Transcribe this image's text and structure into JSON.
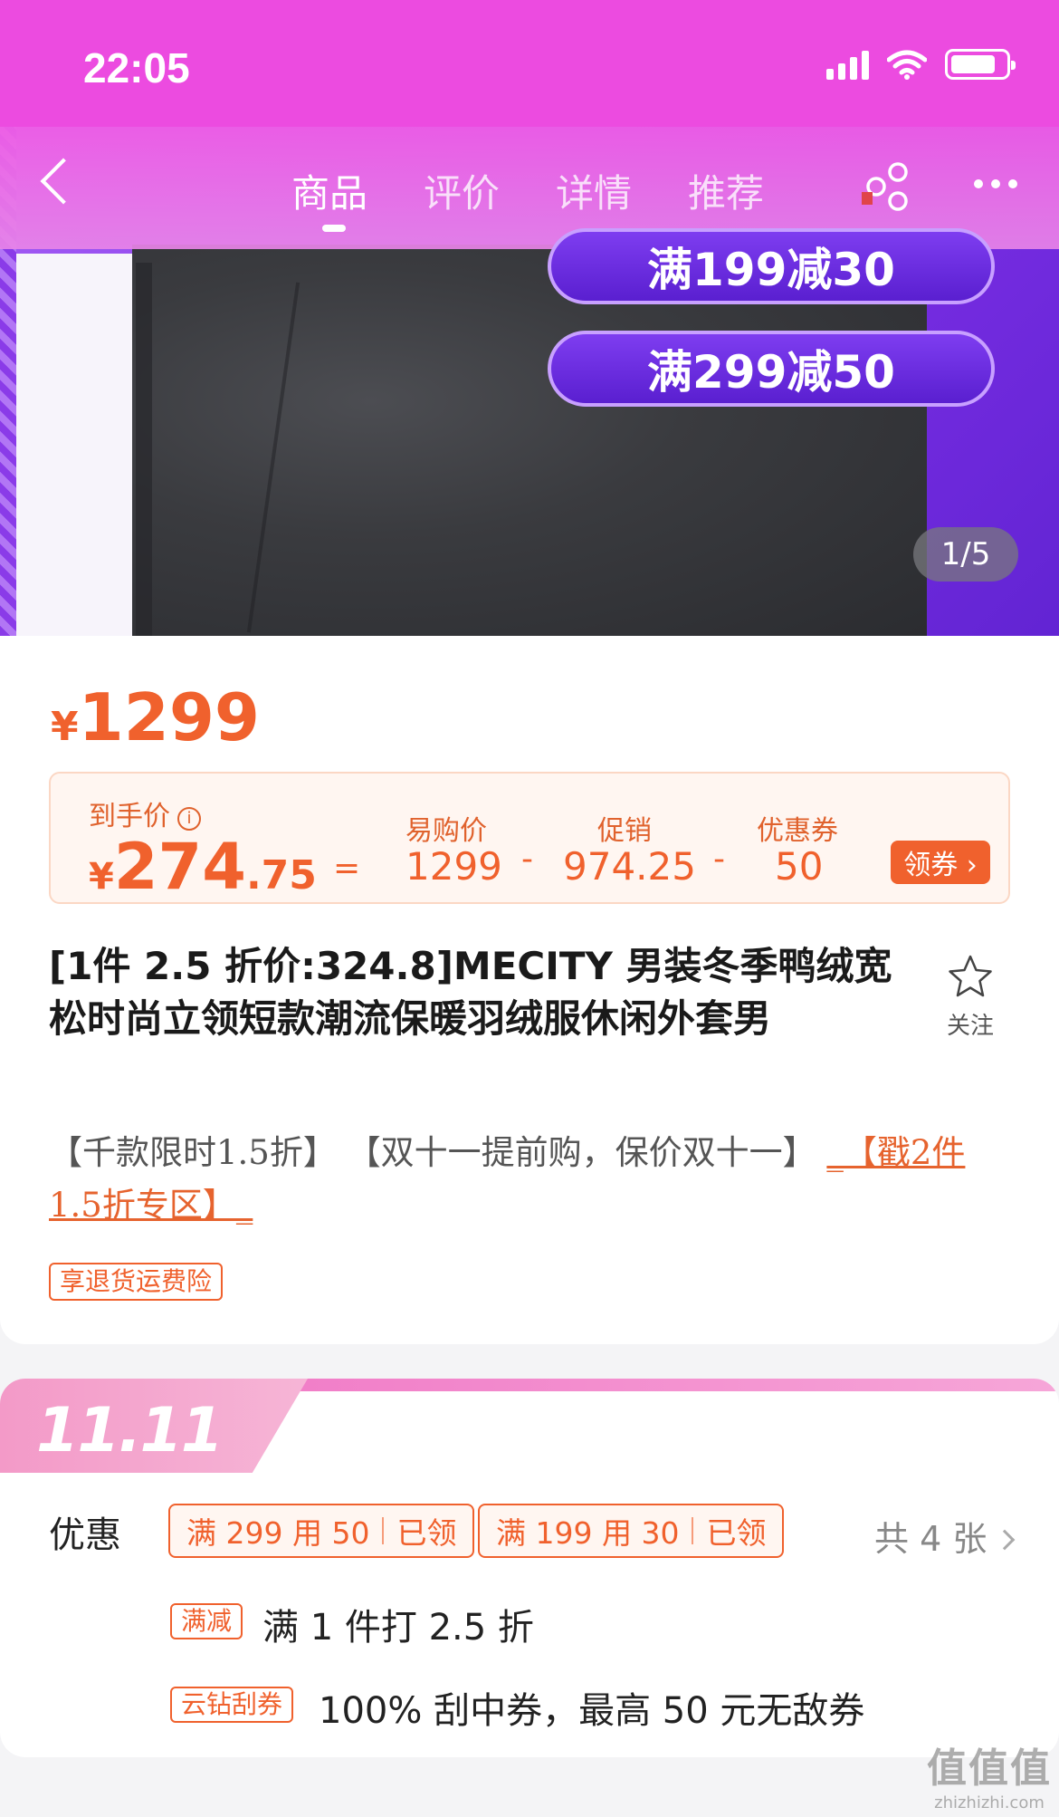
{
  "status_bar": {
    "time": "22:05"
  },
  "nav": {
    "tabs": [
      {
        "label": "商品"
      },
      {
        "label": "评价"
      },
      {
        "label": "详情"
      },
      {
        "label": "推荐"
      }
    ]
  },
  "hero": {
    "promo_pills": [
      "满199减30",
      "满299减50"
    ],
    "image_counter": "1/5"
  },
  "price": {
    "currency": "¥",
    "amount": "1299"
  },
  "final_calc": {
    "label": "到手价",
    "info_icon": "ⓘ",
    "currency": "¥",
    "int": "274",
    "dec": ".75",
    "eq": "=",
    "minus": "-",
    "items": [
      {
        "label": "易购价",
        "value": "1299"
      },
      {
        "label": "促销",
        "value": "974.25"
      },
      {
        "label": "优惠券",
        "value": "50"
      }
    ],
    "coupon_button": "领券 ›"
  },
  "product": {
    "title": "[1件 2.5 折价:324.8]MECITY 男装冬季鸭绒宽松时尚立领短款潮流保暖羽绒服休闲外套男",
    "follow_label": "关注",
    "promo_plain_1": "【千款限时1.5折】 【双十一提前购，保价双十一】 ",
    "promo_link": "_【戳2件1.5折专区】_",
    "tag_return": "享退货运费险"
  },
  "promo_section": {
    "banner": "11.11",
    "label": "优惠",
    "coupons": [
      {
        "text": "满 299 用 50",
        "status": "已领"
      },
      {
        "text": "满 199 用 30",
        "status": "已领"
      }
    ],
    "count": "共 4 张",
    "rows": [
      {
        "tag": "满减",
        "text": "满 1 件打 2.5 折"
      },
      {
        "tag": "云钻刮券",
        "text": "100% 刮中券，最高 50 元无敌券"
      }
    ]
  },
  "watermark": {
    "main": "值值值",
    "sub": "zhizhizhi.com"
  }
}
